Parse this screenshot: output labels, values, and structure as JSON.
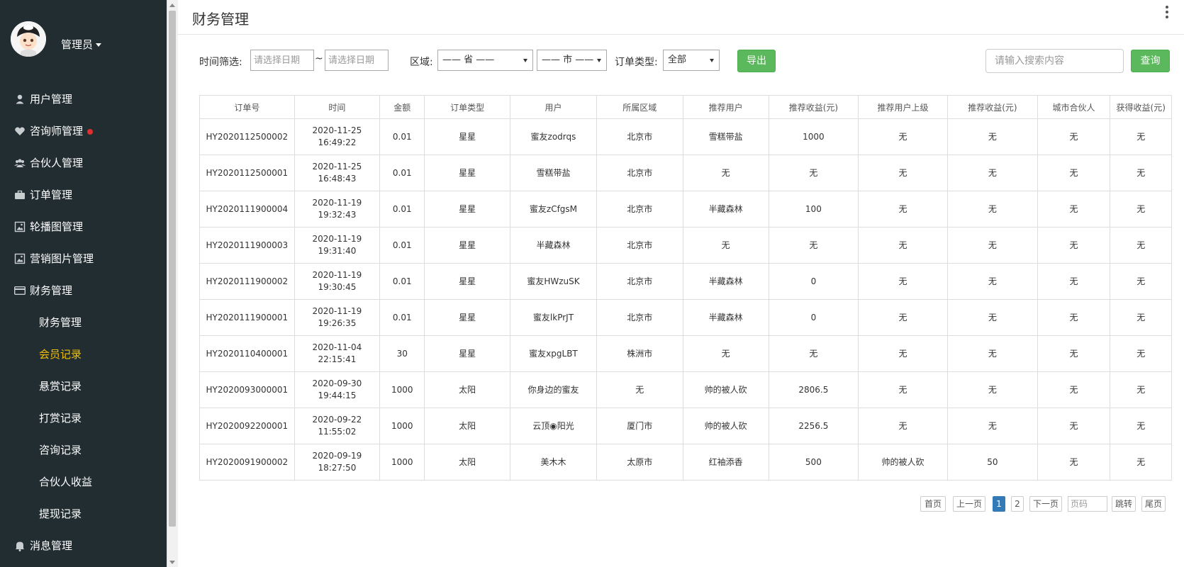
{
  "profile": {
    "name": "管理员",
    "avatar_icon": "avatar-icon"
  },
  "menu": {
    "users": "用户管理",
    "consultants": "咨询师管理",
    "partners": "合伙人管理",
    "orders": "订单管理",
    "banners": "轮播图管理",
    "marketing": "营销图片管理",
    "finance": "财务管理",
    "finance_mgmt": "财务管理",
    "member_records": "会员记录",
    "bounty_records": "悬赏记录",
    "tip_records": "打赏记录",
    "consult_records": "咨询记录",
    "partner_income": "合伙人收益",
    "withdraw_records": "提现记录",
    "messages": "消息管理"
  },
  "header": {
    "title": "财务管理"
  },
  "filter": {
    "time_label": "时间筛选:",
    "date_start_placeholder": "请选择日期",
    "tilde": "~",
    "date_end_placeholder": "请选择日期",
    "region_label": "区域:",
    "province": "—— 省 ——",
    "city": "—— 市 ——",
    "order_type_label": "订单类型:",
    "order_type": "全部",
    "export": "导出",
    "search_placeholder": "请输入搜索内容",
    "search": "查询"
  },
  "table": {
    "headers": [
      "订单号",
      "时间",
      "金额",
      "订单类型",
      "用户",
      "所属区域",
      "推荐用户",
      "推荐收益(元)",
      "推荐用户上级",
      "推荐收益(元)",
      "城市合伙人",
      "获得收益(元)"
    ],
    "rows": [
      [
        "HY2020112500002",
        "2020-11-25",
        "16:49:22",
        "0.01",
        "星星",
        "蜜友zodrqs",
        "北京市",
        "雪糕带盐",
        "1000",
        "无",
        "无",
        "无",
        "无"
      ],
      [
        "HY2020112500001",
        "2020-11-25",
        "16:48:43",
        "0.01",
        "星星",
        "雪糕带盐",
        "北京市",
        "无",
        "无",
        "无",
        "无",
        "无",
        "无"
      ],
      [
        "HY2020111900004",
        "2020-11-19",
        "19:32:43",
        "0.01",
        "星星",
        "蜜友zCfgsM",
        "北京市",
        "半藏森林",
        "100",
        "无",
        "无",
        "无",
        "无"
      ],
      [
        "HY2020111900003",
        "2020-11-19",
        "19:31:40",
        "0.01",
        "星星",
        "半藏森林",
        "北京市",
        "无",
        "无",
        "无",
        "无",
        "无",
        "无"
      ],
      [
        "HY2020111900002",
        "2020-11-19",
        "19:30:45",
        "0.01",
        "星星",
        "蜜友HWzuSK",
        "北京市",
        "半藏森林",
        "0",
        "无",
        "无",
        "无",
        "无"
      ],
      [
        "HY2020111900001",
        "2020-11-19",
        "19:26:35",
        "0.01",
        "星星",
        "蜜友lkPrJT",
        "北京市",
        "半藏森林",
        "0",
        "无",
        "无",
        "无",
        "无"
      ],
      [
        "HY2020110400001",
        "2020-11-04",
        "22:15:41",
        "30",
        "星星",
        "蜜友xpgLBT",
        "株洲市",
        "无",
        "无",
        "无",
        "无",
        "无",
        "无"
      ],
      [
        "HY2020093000001",
        "2020-09-30",
        "19:44:15",
        "1000",
        "太阳",
        "你身边的蜜友",
        "无",
        "帅的被人砍",
        "2806.5",
        "无",
        "无",
        "无",
        "无"
      ],
      [
        "HY2020092200001",
        "2020-09-22",
        "11:55:02",
        "1000",
        "太阳",
        "云顶◉阳光",
        "厦门市",
        "帅的被人砍",
        "2256.5",
        "无",
        "无",
        "无",
        "无"
      ],
      [
        "HY2020091900002",
        "2020-09-19",
        "18:27:50",
        "1000",
        "太阳",
        "美木木",
        "太原市",
        "红袖添香",
        "500",
        "帅的被人砍",
        "50",
        "无",
        "无"
      ]
    ]
  },
  "pager": {
    "first": "首页",
    "prev": "上一页",
    "p1": "1",
    "p2": "2",
    "next": "下一页",
    "page_placeholder": "页码",
    "jump": "跳转",
    "last": "尾页"
  },
  "colors": {
    "sidebar_bg": "#222d32",
    "active": "#f3c000",
    "green": "#5cb85c",
    "page_active": "#337ab7"
  }
}
